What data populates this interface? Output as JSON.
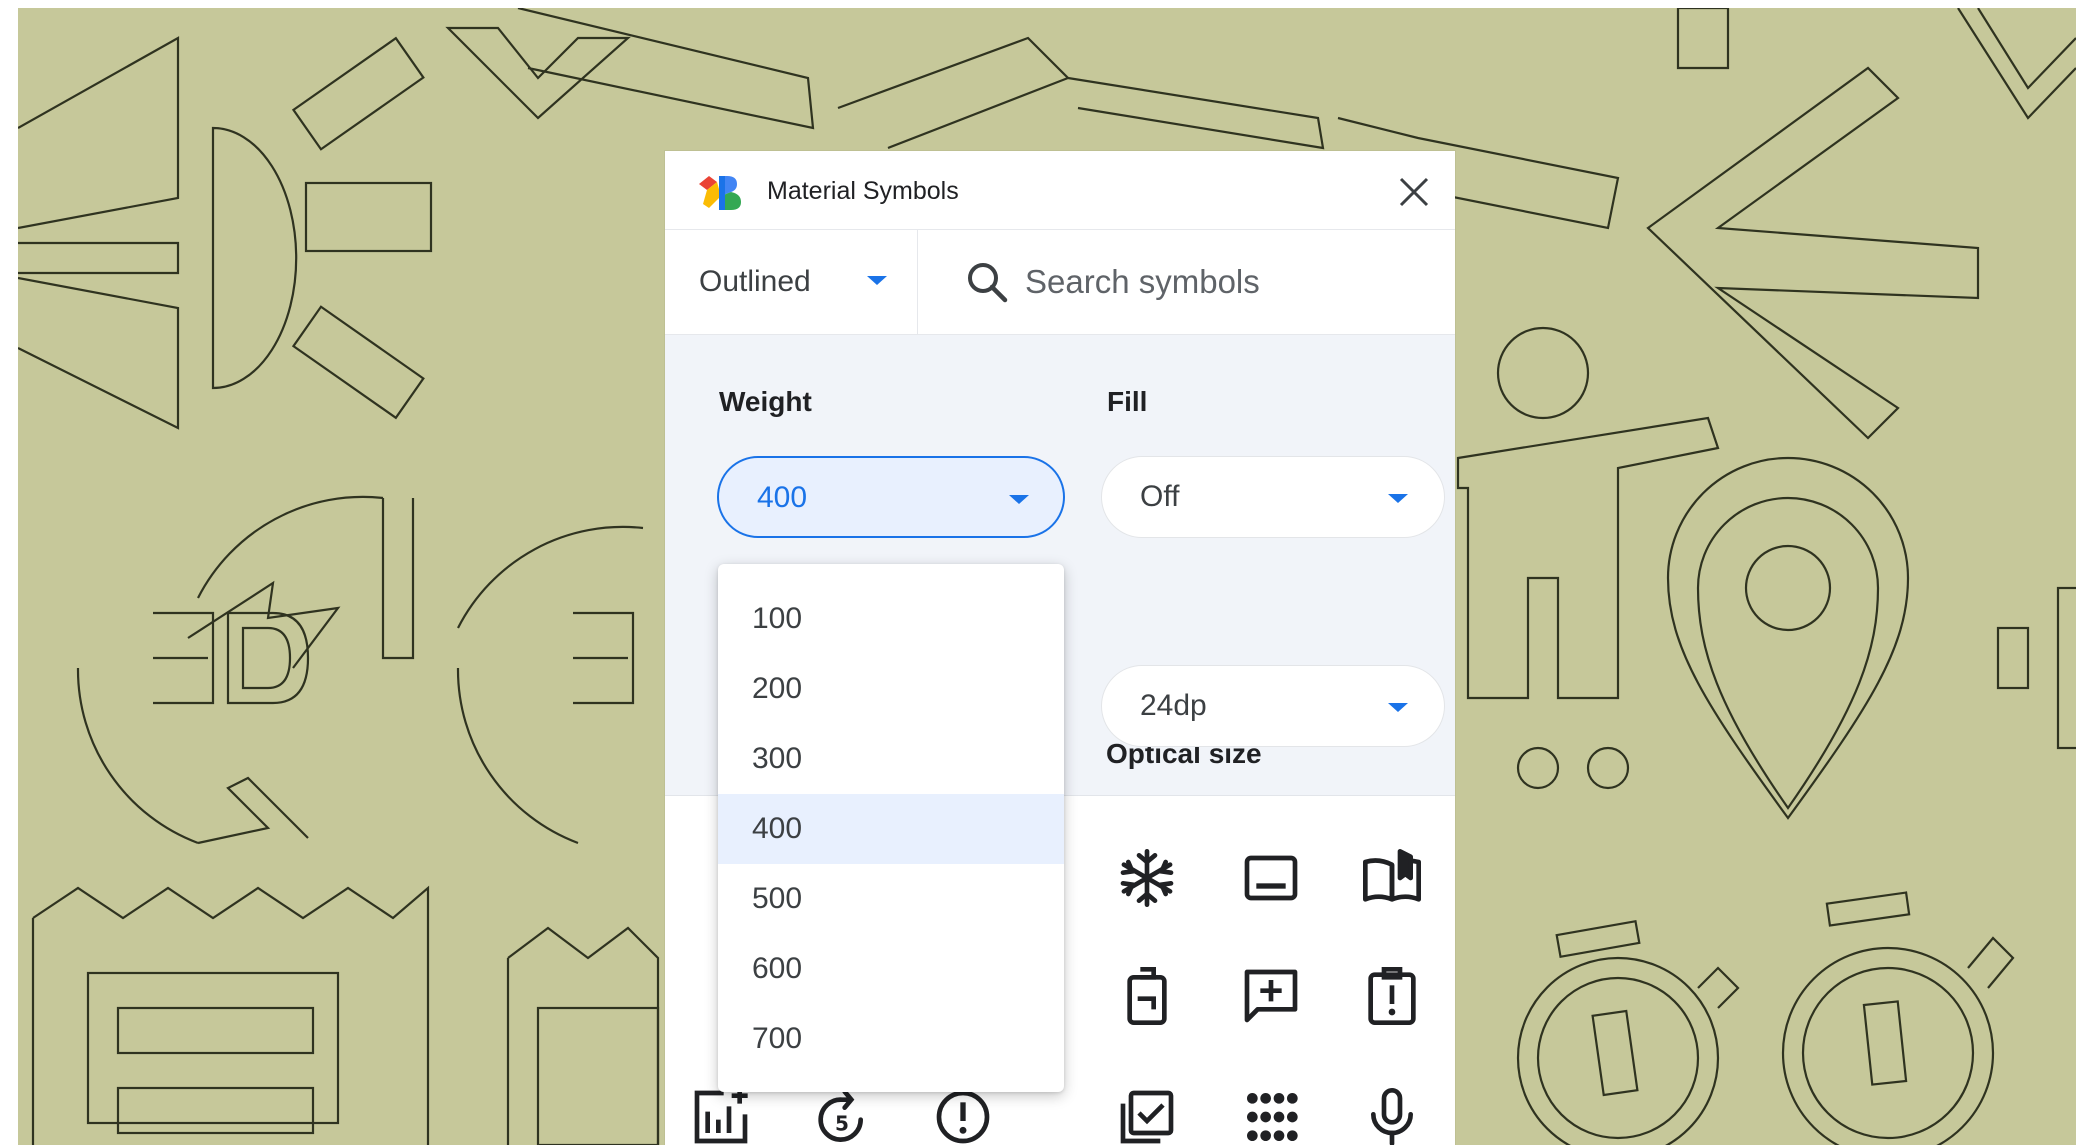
{
  "window": {
    "title": "Material Symbols"
  },
  "search": {
    "style_value": "Outlined",
    "placeholder": "Search symbols"
  },
  "controls": {
    "weight_label": "Weight",
    "weight_value": "400",
    "fill_label": "Fill",
    "fill_value": "Off",
    "optical_size_label": "Optical size",
    "optical_size_value": "24dp"
  },
  "weight_menu": {
    "selected": "400",
    "options": [
      "100",
      "200",
      "300",
      "400",
      "500",
      "600",
      "700"
    ]
  },
  "icons": [
    "ac-unit-icon",
    "subtitles-icon",
    "auto-stories-icon",
    "battery-icon",
    "add-comment-icon",
    "clipboard-alert-icon",
    "add-chart-icon",
    "forward-5-icon",
    "error-icon",
    "checkbox-list-icon",
    "dialpad-icon",
    "mic-icon"
  ],
  "colors": {
    "background": "#c6c89a",
    "accent": "#1a73e8",
    "panel": "#ffffff",
    "controls_bg": "#f1f4f9",
    "selected_bg": "#e8f0fe"
  }
}
